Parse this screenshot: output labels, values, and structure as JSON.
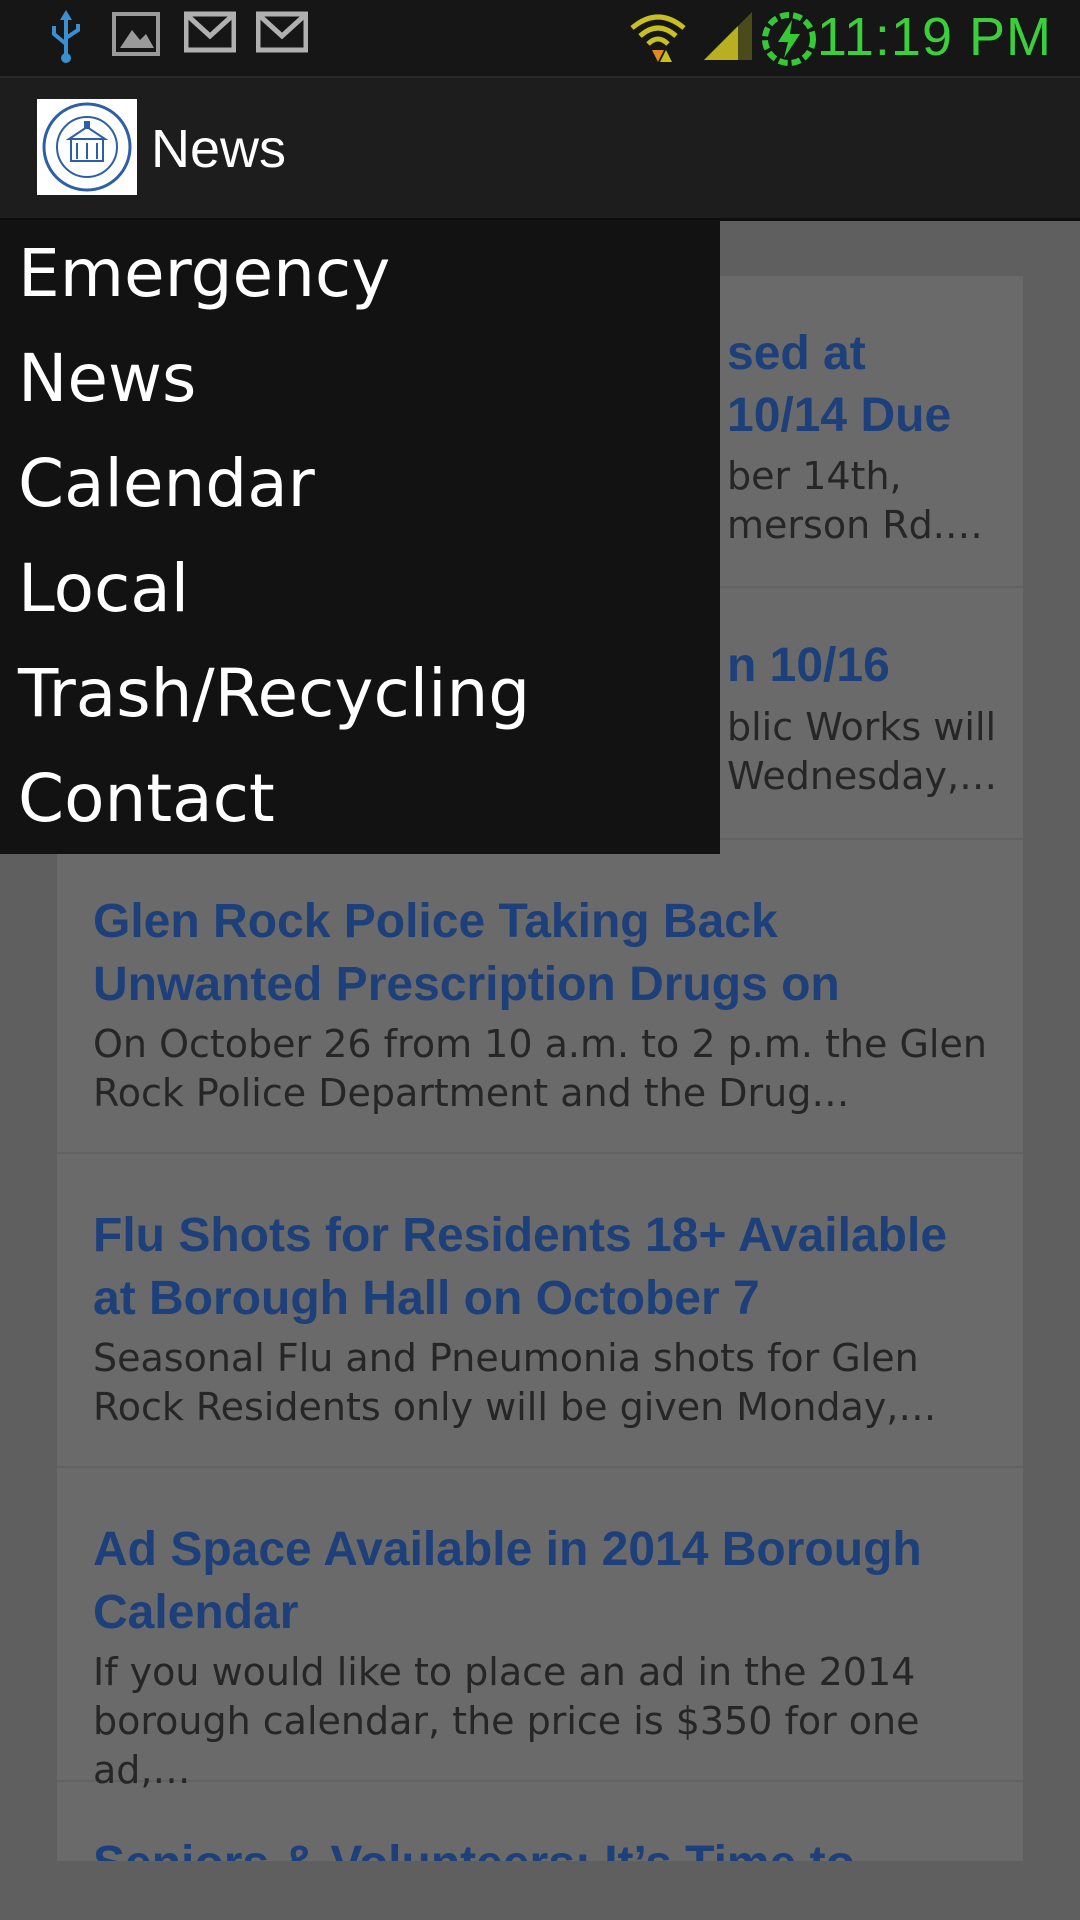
{
  "status_bar": {
    "time": "11:19 PM",
    "icons": [
      "usb-icon",
      "gallery-icon",
      "gmail-icon",
      "gmail-icon",
      "wifi-icon",
      "signal-icon",
      "battery-charging-icon"
    ],
    "clock_color": "#3ccf3c"
  },
  "action_bar": {
    "title": "News",
    "logo_text": "BOROUGH OF GLEN ROCK NEW JERSEY"
  },
  "drawer": {
    "items": [
      {
        "label": "Emergency"
      },
      {
        "label": "News"
      },
      {
        "label": "Calendar"
      },
      {
        "label": "Local"
      },
      {
        "label": "Trash/Recycling"
      },
      {
        "label": "Contact"
      }
    ]
  },
  "news": {
    "items": [
      {
        "title_line1": "sed at",
        "title_line2": "10/14 Due",
        "text_line1": "ber 14th,",
        "text_line2": "merson Rd.…"
      },
      {
        "title_line1": "n 10/16",
        "text_line1": "blic Works will",
        "text_line2": "Wednesday,…"
      },
      {
        "title_line1": "Glen Rock Police Taking Back",
        "title_line2": "Unwanted Prescription Drugs on",
        "text_line1": "On October 26 from 10 a.m. to 2 p.m. the Glen",
        "text_line2": "Rock Police Department and the Drug…"
      },
      {
        "title_line1": "Flu Shots for Residents 18+ Available",
        "title_line2": "at Borough Hall on October 7",
        "text_line1": "Seasonal Flu and Pneumonia shots for Glen",
        "text_line2": "Rock Residents only will be given Monday,…"
      },
      {
        "title_line1": "Ad Space Available in 2014 Borough",
        "title_line2": "Calendar",
        "text_line1": "If you would like to place an ad in the 2014",
        "text_line2": "borough calendar, the price is $350 for one ad,…"
      },
      {
        "title_line1": "Seniors & Volunteers: It’s Time to"
      }
    ]
  },
  "colors": {
    "title_blue": "#1d3f7a",
    "drawer_bg": "#121212",
    "scrim": "#5f5f5f"
  }
}
